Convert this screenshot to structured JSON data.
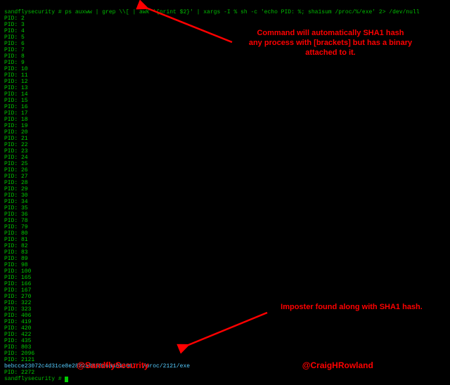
{
  "prompt_user": "sandflysecurity #",
  "command": " ps auxww | grep \\\\[ | awk '{print $2}' | xargs -I % sh -c 'echo PID: %; sha1sum /proc/%/exe' 2> /dev/null",
  "pids_top": [
    "2",
    "3",
    "4",
    "5",
    "6",
    "7",
    "8",
    "9",
    "10",
    "11",
    "12",
    "13",
    "14",
    "15",
    "16",
    "17",
    "18",
    "19",
    "20",
    "21",
    "22",
    "23",
    "24",
    "25",
    "26",
    "27",
    "28",
    "29",
    "30",
    "34",
    "35",
    "36",
    "78",
    "79",
    "80",
    "81",
    "82",
    "83",
    "89",
    "98",
    "100",
    "165",
    "166",
    "167",
    "270",
    "322",
    "323",
    "406",
    "419",
    "420",
    "422",
    "435",
    "803",
    "2096"
  ],
  "pid_imposter": "2121",
  "sha1_line": "bebcce23072c4d31ce8e2822a0858d6aa813067  /proc/2121/exe",
  "pid_last": "2272",
  "annotation_top": "Command will automatically SHA1 hash\nany process with [brackets] but has a binary\nattached to it.",
  "annotation_bottom": "Imposter found along with SHA1 hash.",
  "footer_left": "@SandflySecurity",
  "footer_right": "@CraigHRowland"
}
